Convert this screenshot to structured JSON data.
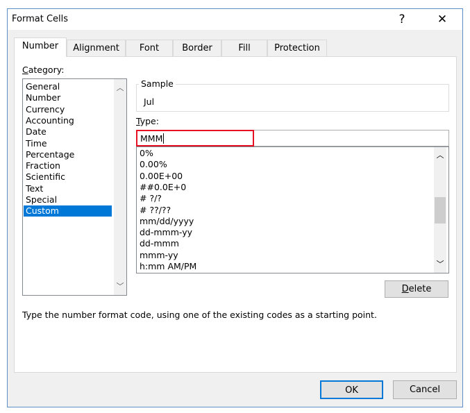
{
  "window": {
    "title": "Format Cells",
    "help_icon": "?",
    "close_icon": "✕"
  },
  "tabs": [
    {
      "label": "Number",
      "selected": true
    },
    {
      "label": "Alignment"
    },
    {
      "label": "Font"
    },
    {
      "label": "Border"
    },
    {
      "label": "Fill"
    },
    {
      "label": "Protection"
    }
  ],
  "category": {
    "label_accel": "C",
    "label_rest": "ategory:",
    "items": [
      "General",
      "Number",
      "Currency",
      "Accounting",
      "Date",
      "Time",
      "Percentage",
      "Fraction",
      "Scientific",
      "Text",
      "Special",
      "Custom"
    ],
    "selected": "Custom"
  },
  "sample": {
    "label": "Sample",
    "value": "Jul"
  },
  "type": {
    "label_accel": "T",
    "label_rest": "ype:",
    "value": "MMM",
    "formats": [
      "0%",
      "0.00%",
      "0.00E+00",
      "##0.0E+0",
      "# ?/?",
      "# ??/??",
      "mm/dd/yyyy",
      "dd-mmm-yy",
      "dd-mmm",
      "mmm-yy",
      "h:mm AM/PM"
    ]
  },
  "delete_button": {
    "accel": "D",
    "rest": "elete"
  },
  "help_text": "Type the number format code, using one of the existing codes as a starting point.",
  "ok_label": "OK",
  "cancel_label": "Cancel",
  "colors": {
    "selection": "#0078d7",
    "highlight_border": "#e81123",
    "ok_border": "#0078d7"
  }
}
